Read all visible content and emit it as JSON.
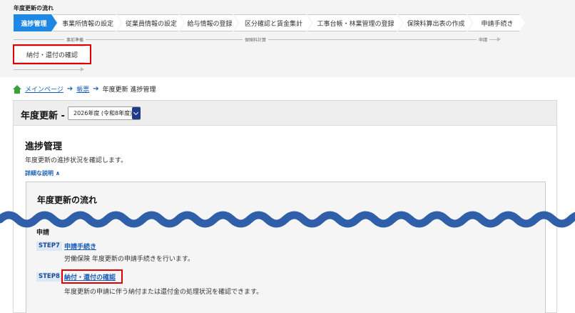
{
  "flow": {
    "title": "年度更新の流れ",
    "steps": [
      {
        "label": "進捗管理"
      },
      {
        "label": "事業所情報の設定"
      },
      {
        "label": "従業員情報の設定"
      },
      {
        "label": "給与情報の登録"
      },
      {
        "label": "区分確認と賃金集計"
      },
      {
        "label": "工事台帳・林業管理の登録"
      },
      {
        "label": "保険料算出表の作成"
      },
      {
        "label": "申請手続き"
      }
    ],
    "second_row_step": "納付・還付の確認",
    "phases": [
      "事前準備",
      "保険料計算",
      "申請"
    ],
    "active_color": "#1e88e5",
    "highlight_color": "#e00000"
  },
  "breadcrumb": {
    "home": "メインページ",
    "items": [
      "帳票",
      "年度更新 進捗管理"
    ],
    "home_icon": "home-icon",
    "separator": "➔"
  },
  "year": {
    "title": "年度更新 -",
    "selected": "2026年度 (令和8年度)"
  },
  "section": {
    "title": "進捗管理",
    "description": "年度更新の進捗状況を確認します。",
    "details_toggle": "詳細な説明 ∧"
  },
  "flow_box": {
    "title": "年度更新の流れ",
    "group_label": "申請",
    "items": [
      {
        "tag": "STEP7",
        "link": "申請手続き",
        "desc": "労働保険 年度更新の申請手続きを行います。"
      },
      {
        "tag": "STEP8",
        "link": "納付・還付の確認",
        "desc": "年度更新の申請に伴う納付または還付金の処理状況を確認できます。"
      }
    ]
  },
  "wave_color": "#2f5fa8"
}
